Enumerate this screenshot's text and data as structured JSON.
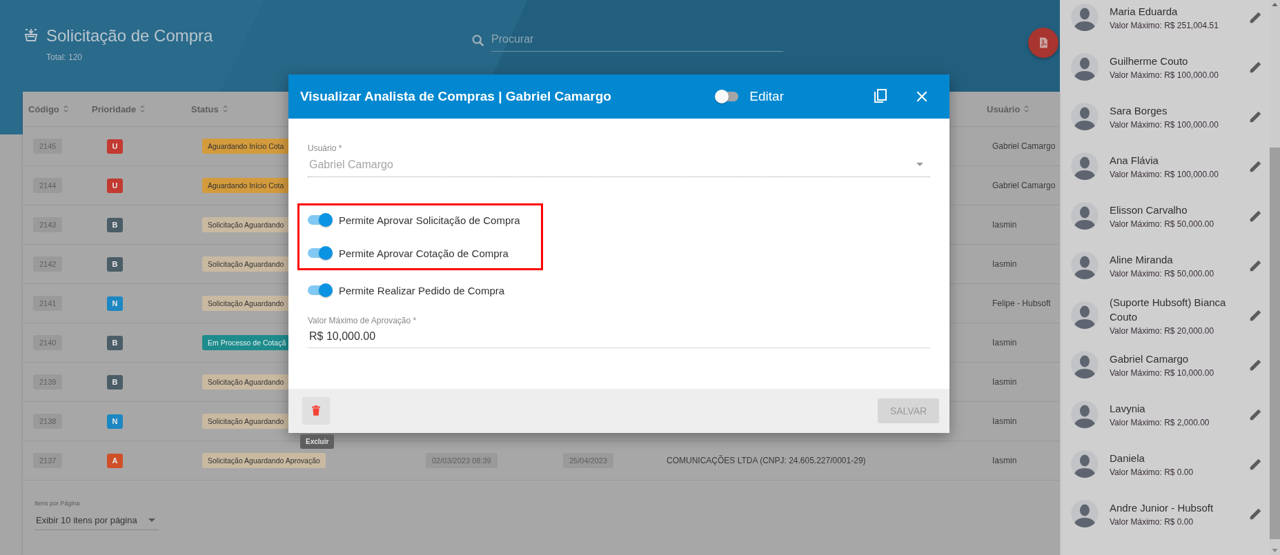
{
  "header": {
    "title": "Solicitação de Compra",
    "total": "Total: 120"
  },
  "search": {
    "placeholder": "Procurar"
  },
  "table": {
    "columns": [
      {
        "label": "Código"
      },
      {
        "label": "Prioridade"
      },
      {
        "label": "Status"
      },
      {
        "label": "Usuário"
      }
    ],
    "rows": [
      {
        "code": "2145",
        "priority": {
          "label": "U",
          "color": "#c23a31"
        },
        "status": {
          "label": "Aguardando Início Cota",
          "color": "#d49b3d"
        },
        "user": "Gabriel Camargo"
      },
      {
        "code": "2144",
        "priority": {
          "label": "U",
          "color": "#c23a31"
        },
        "status": {
          "label": "Aguardando Início Cota",
          "color": "#d49b3d"
        },
        "user": "Gabriel Camargo"
      },
      {
        "code": "2143",
        "priority": {
          "label": "B",
          "color": "#4b5d67"
        },
        "status": {
          "label": "Solicitação Aguardando",
          "color": "#c9b9a1"
        },
        "user": "Iasmin"
      },
      {
        "code": "2142",
        "priority": {
          "label": "B",
          "color": "#4b5d67"
        },
        "status": {
          "label": "Solicitação Aguardando",
          "color": "#c9b9a1"
        },
        "user": "Iasmin"
      },
      {
        "code": "2141",
        "priority": {
          "label": "N",
          "color": "#1c87c2"
        },
        "status": {
          "label": "Solicitação Aguardando",
          "color": "#c9b9a1"
        },
        "user": "Felipe - Hubsoft"
      },
      {
        "code": "2140",
        "priority": {
          "label": "B",
          "color": "#4b5d67"
        },
        "status": {
          "label": "Em Processo de Cotaçã",
          "color": "#1e8b8c"
        },
        "user": "Iasmin"
      },
      {
        "code": "2139",
        "priority": {
          "label": "B",
          "color": "#4b5d67"
        },
        "status": {
          "label": "Solicitação Aguardando",
          "color": "#c9b9a1"
        },
        "user": "Iasmin"
      },
      {
        "code": "2138",
        "priority": {
          "label": "N",
          "color": "#1c87c2"
        },
        "status": {
          "label": "Solicitação Aguardando",
          "color": "#c9b9a1"
        },
        "user": "Iasmin"
      },
      {
        "code": "2137",
        "priority": {
          "label": "A",
          "color": "#cf4f28"
        },
        "status": {
          "label": "Solicitação Aguardando Aprovação",
          "color": "#c9b9a1"
        },
        "date": "02/03/2023 08:39",
        "deadline": "25/04/2023",
        "supplier": "COMUNICAÇÕES LTDA (CNPJ: 24.605.227/0001-29)",
        "user": "Iasmin"
      }
    ]
  },
  "pagination": {
    "label": "Itens por Página",
    "value": "Exibir 10 itens por página"
  },
  "modal": {
    "title": "Visualizar Analista de Compras | Gabriel Camargo",
    "edit_toggle": {
      "label": "Editar",
      "on": false
    },
    "user_field": {
      "label": "Usuário *",
      "value": "Gabriel Camargo",
      "disabled": true
    },
    "highlight_frame": {
      "toggles": [
        {
          "label": "Permite Aprovar Solicitação de Compra",
          "on": true
        },
        {
          "label": "Permite Aprovar Cotação de Compra",
          "on": true
        }
      ]
    },
    "toggles": [
      {
        "label": "Permite Realizar Pedido de Compra",
        "on": true
      }
    ],
    "max_value_field": {
      "label": "Valor Máximo de Aprovação *",
      "value": "R$ 10,000.00"
    },
    "delete_tooltip": "Excluir",
    "save_button": {
      "label": "SALVAR",
      "disabled": true
    }
  },
  "analysts": [
    {
      "name": "Maria Eduarda",
      "max_value": "Valor Máximo: R$ 251,004.51"
    },
    {
      "name": "Guilherme Couto",
      "max_value": "Valor Máximo: R$ 100,000.00"
    },
    {
      "name": "Sara Borges",
      "max_value": "Valor Máximo: R$ 100,000.00"
    },
    {
      "name": "Ana Flávia",
      "max_value": "Valor Máximo: R$ 100,000.00"
    },
    {
      "name": "Elisson Carvalho",
      "max_value": "Valor Máximo: R$ 50,000.00"
    },
    {
      "name": "Aline Miranda",
      "max_value": "Valor Máximo: R$ 50,000.00"
    },
    {
      "name": "(Suporte Hubsoft) Bianca Couto",
      "max_value": "Valor Máximo: R$ 20,000.00"
    },
    {
      "name": "Gabriel Camargo",
      "max_value": "Valor Máximo: R$ 10,000.00"
    },
    {
      "name": "Lavynia",
      "max_value": "Valor Máximo: R$ 2,000.00"
    },
    {
      "name": "Daniela",
      "max_value": "Valor Máximo: R$ 0.00"
    },
    {
      "name": "Andre Junior - Hubsoft",
      "max_value": "Valor Máximo: R$ 0.00"
    }
  ]
}
